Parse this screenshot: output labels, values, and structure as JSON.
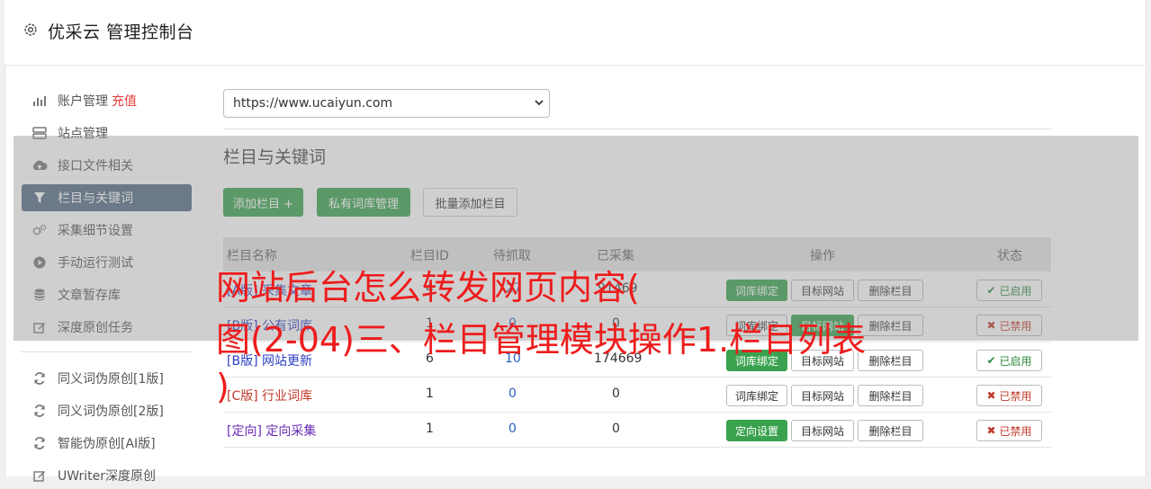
{
  "header": {
    "title": "优采云 管理控制台"
  },
  "sidebar": {
    "items": [
      {
        "icon": "bar-chart-icon",
        "label": "账户管理",
        "extra": "充值"
      },
      {
        "icon": "server-icon",
        "label": "站点管理"
      },
      {
        "icon": "cloud-upload-icon",
        "label": "接口文件相关"
      },
      {
        "icon": "filter-icon",
        "label": "栏目与关键词"
      },
      {
        "icon": "gears-icon",
        "label": "采集细节设置"
      },
      {
        "icon": "play-circle-icon",
        "label": "手动运行测试"
      },
      {
        "icon": "database-icon",
        "label": "文章暂存库"
      },
      {
        "icon": "edit-icon",
        "label": "深度原创任务"
      },
      {
        "icon": "refresh-icon",
        "label": "同义词伪原创[1版]"
      },
      {
        "icon": "refresh-icon",
        "label": "同义词伪原创[2版]"
      },
      {
        "icon": "refresh-icon",
        "label": "智能伪原创[AI版]"
      },
      {
        "icon": "edit-icon",
        "label": "UWriter深度原创"
      }
    ]
  },
  "site_select": {
    "value": "https://www.ucaiyun.com"
  },
  "main": {
    "title": "栏目与关键词",
    "buttons": {
      "add": "添加栏目 +",
      "private": "私有词库管理",
      "batch": "批量添加栏目"
    }
  },
  "table": {
    "headers": {
      "name": "栏目名称",
      "id": "栏目ID",
      "pending": "待抓取",
      "collected": "已采集",
      "ops": "操作",
      "status": "状态"
    },
    "rows": [
      {
        "tag": "[A版]",
        "name": "采集文章",
        "id": "4",
        "pending": "27",
        "collected": "91469",
        "op1": "词库绑定",
        "op2": "目标网站",
        "op3": "删除栏目",
        "status": "已启用"
      },
      {
        "tag": "[B版]",
        "name": "公有词库",
        "id": "1",
        "pending": "0",
        "collected": "0",
        "op1": "词库绑定",
        "op2": "目标网站",
        "op3": "删除栏目",
        "status": "已禁用"
      },
      {
        "tag": "[B版]",
        "name": "网站更新",
        "id": "6",
        "pending": "10",
        "collected": "174669",
        "op1": "词库绑定",
        "op2": "目标网站",
        "op3": "删除栏目",
        "status": "已启用"
      },
      {
        "tag": "[C版]",
        "name": "行业词库",
        "id": "1",
        "pending": "0",
        "collected": "0",
        "op1": "词库绑定",
        "op2": "目标网站",
        "op3": "删除栏目",
        "status": "已禁用"
      },
      {
        "tag": "[定向]",
        "name": "定向采集",
        "id": "1",
        "pending": "0",
        "collected": "0",
        "op1": "定向设置",
        "op2": "目标网站",
        "op3": "删除栏目",
        "status": "已禁用"
      }
    ]
  },
  "overlay": {
    "line1": "网站后台怎么转发网页内容(",
    "line2": "图(2-04)三、栏目管理模块操作1.栏目列表",
    "line3": ")"
  },
  "colors": {
    "accent_green": "#3aa24e",
    "sidebar_active": "#536c86",
    "overlay_text": "#ee1c1c"
  }
}
